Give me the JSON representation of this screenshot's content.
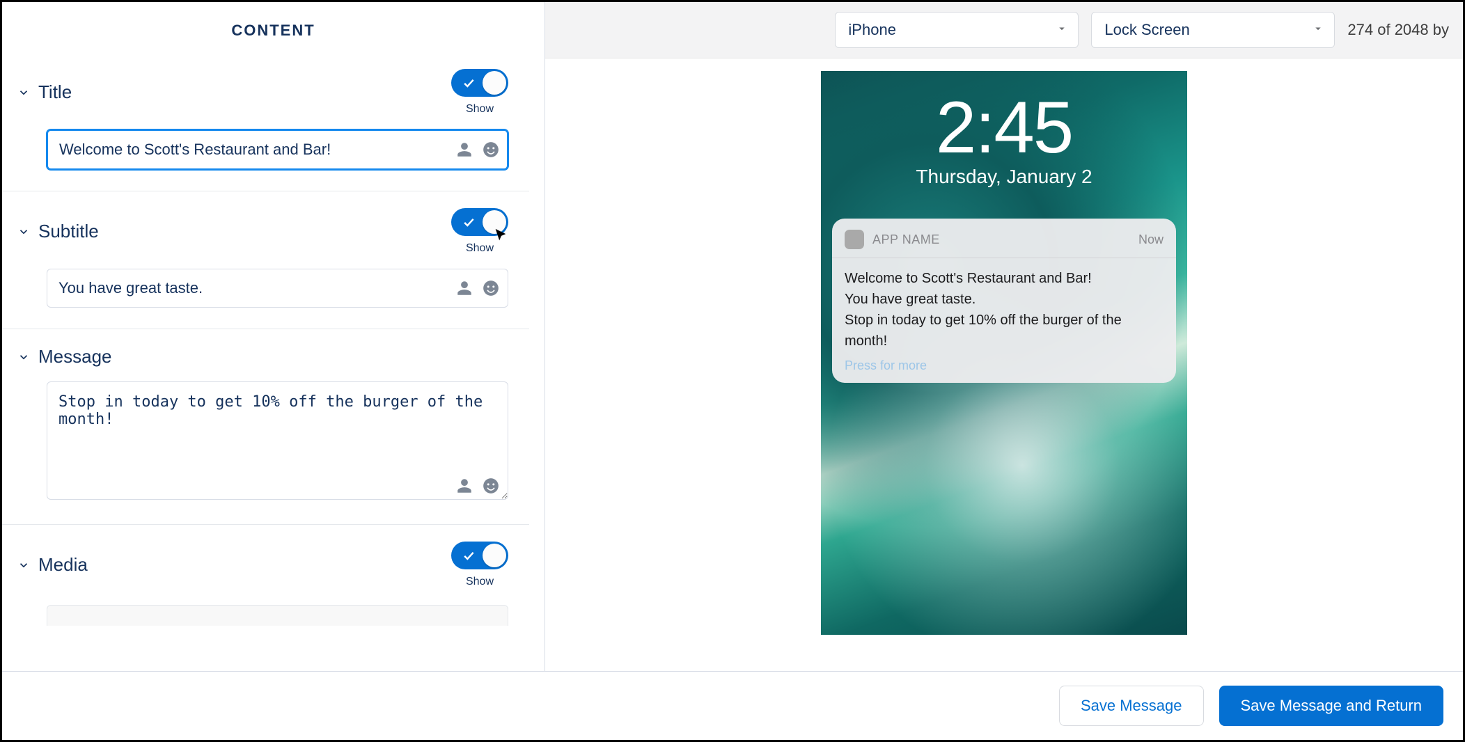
{
  "panel": {
    "heading": "CONTENT",
    "title": {
      "label": "Title",
      "toggle_caption": "Show",
      "value": "Welcome to Scott's Restaurant and Bar!"
    },
    "subtitle": {
      "label": "Subtitle",
      "toggle_caption": "Show",
      "value": "You have great taste."
    },
    "message": {
      "label": "Message",
      "value": "Stop in today to get 10% off the burger of the month!"
    },
    "media": {
      "label": "Media",
      "toggle_caption": "Show"
    }
  },
  "preview": {
    "device_select": "iPhone",
    "view_select": "Lock Screen",
    "char_count": "274 of 2048 by",
    "lock_time": "2:45",
    "lock_date": "Thursday, January 2",
    "notif": {
      "app_name": "APP NAME",
      "time_label": "Now",
      "title": "Welcome to Scott's Restaurant and Bar!",
      "subtitle": "You have great taste.",
      "message": "Stop in today to get 10% off the burger of the month!",
      "press_more": "Press for more"
    }
  },
  "footer": {
    "save": "Save Message",
    "save_return": "Save Message and Return"
  }
}
